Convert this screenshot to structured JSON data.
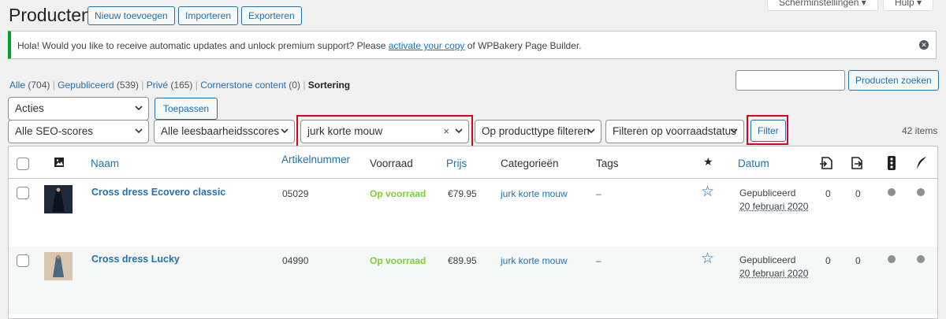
{
  "header": {
    "title": "Producten",
    "add_new": "Nieuw toevoegen",
    "import": "Importeren",
    "export": "Exporteren",
    "screen_options": "Scherminstellingen",
    "help": "Hulp"
  },
  "notice": {
    "text_before": "Hola! Would you like to receive automatic updates and unlock premium support? Please ",
    "link": "activate your copy",
    "text_after": " of WPBakery Page Builder."
  },
  "views": [
    {
      "label": "Alle",
      "count": "(704)"
    },
    {
      "label": "Gepubliceerd",
      "count": "(539)"
    },
    {
      "label": "Privé",
      "count": "(165)"
    },
    {
      "label": "Cornerstone content",
      "count": "(0)"
    },
    {
      "label": "Sortering"
    }
  ],
  "search": {
    "button": "Producten zoeken",
    "value": ""
  },
  "bulk": {
    "select": "Acties",
    "apply": "Toepassen"
  },
  "filters": {
    "seo": "Alle SEO-scores",
    "readability": "Alle leesbaarheidsscores",
    "category": "jurk korte mouw",
    "product_type": "Op producttype filteren",
    "stock": "Filteren op voorraadstatus",
    "filter_button": "Filter",
    "items_count": "42 items"
  },
  "table": {
    "columns": {
      "name": "Naam",
      "sku": "Artikelnummer",
      "stock": "Voorraad",
      "price": "Prijs",
      "categories": "Categorieën",
      "tags": "Tags",
      "date": "Datum"
    },
    "rows": [
      {
        "name": "Cross dress Ecovero classic",
        "sku": "05029",
        "stock": "Op voorraad",
        "price": "€79.95",
        "category": "jurk korte mouw",
        "tags": "–",
        "status": "Gepubliceerd",
        "date": "20 februari 2020",
        "links_out": "0",
        "links_in": "0"
      },
      {
        "name": "Cross dress Lucky",
        "sku": "04990",
        "stock": "Op voorraad",
        "price": "€89.95",
        "category": "jurk korte mouw",
        "tags": "–",
        "status": "Gepubliceerd",
        "date": "20 februari 2020",
        "links_out": "0",
        "links_in": "0"
      }
    ]
  },
  "colors": {
    "link": "#2271b1",
    "in_stock": "#7ad03a",
    "highlight": "#e0001a",
    "notice_border": "#00a32a"
  }
}
